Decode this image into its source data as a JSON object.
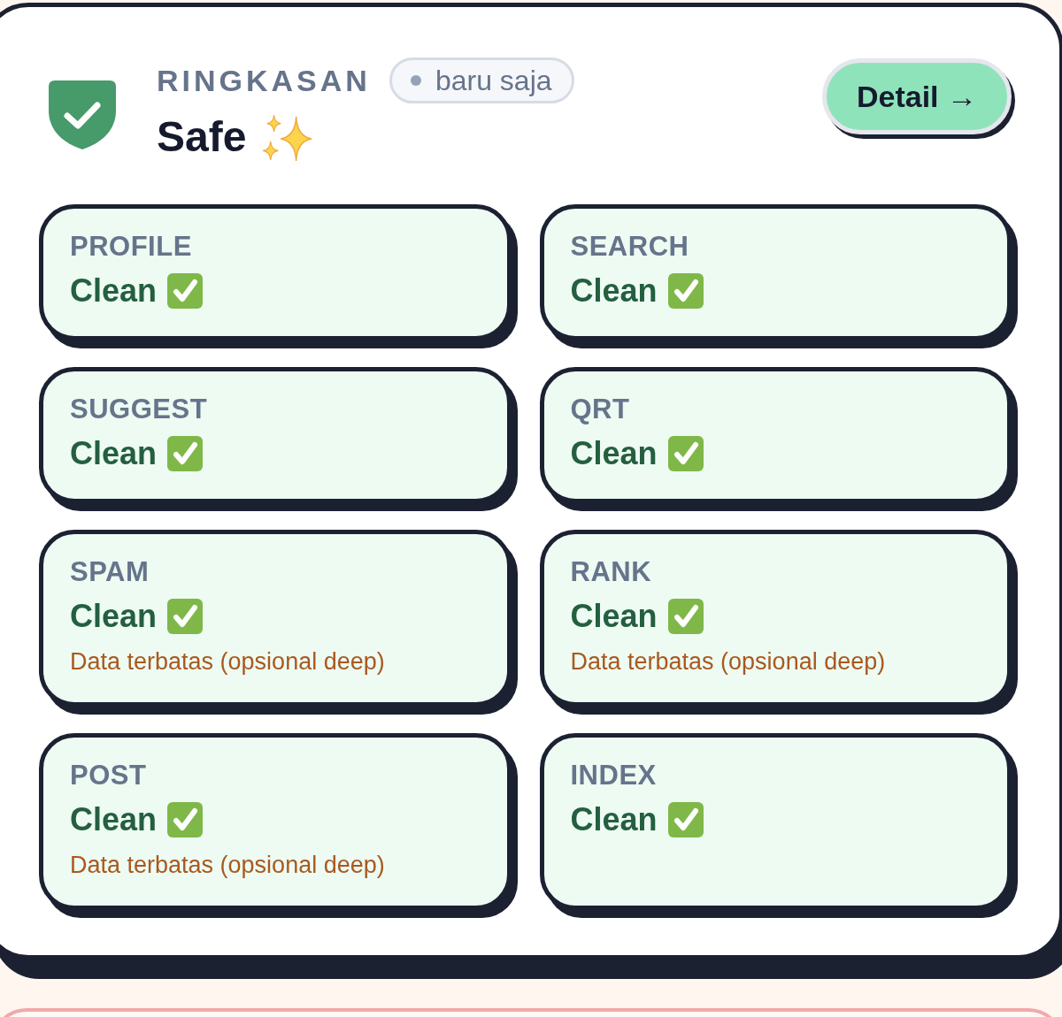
{
  "summary": {
    "label": "RINGKASAN",
    "timestamp": "baru saja",
    "status": "Safe"
  },
  "detail_button": {
    "label": "Detail →"
  },
  "checks": [
    {
      "name": "PROFILE",
      "result": "Clean"
    },
    {
      "name": "SEARCH",
      "result": "Clean"
    },
    {
      "name": "SUGGEST",
      "result": "Clean"
    },
    {
      "name": "QRT",
      "result": "Clean"
    },
    {
      "name": "SPAM",
      "result": "Clean",
      "note": "Data terbatas (opsional deep)"
    },
    {
      "name": "RANK",
      "result": "Clean",
      "note": "Data terbatas (opsional deep)"
    },
    {
      "name": "POST",
      "result": "Clean",
      "note": "Data terbatas (opsional deep)"
    },
    {
      "name": "INDEX",
      "result": "Clean"
    }
  ]
}
